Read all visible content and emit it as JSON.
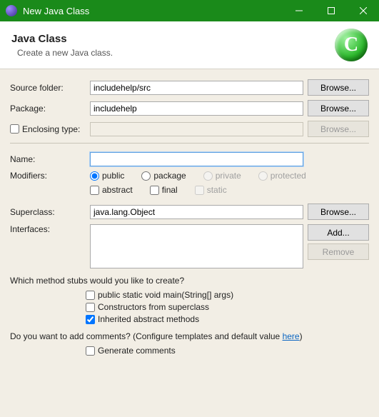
{
  "window": {
    "title": "New Java Class"
  },
  "header": {
    "heading": "Java Class",
    "description": "Create a new Java class.",
    "icon_letter": "C"
  },
  "labels": {
    "source_folder": "Source folder:",
    "package": "Package:",
    "enclosing_type": "Enclosing type:",
    "name": "Name:",
    "modifiers": "Modifiers:",
    "superclass": "Superclass:",
    "interfaces": "Interfaces:"
  },
  "fields": {
    "source_folder": "includehelp/src",
    "package": "includehelp",
    "enclosing_type": "",
    "name": "",
    "superclass": "java.lang.Object"
  },
  "buttons": {
    "browse": "Browse...",
    "add": "Add...",
    "remove": "Remove"
  },
  "modifiers": {
    "public": "public",
    "package": "package",
    "private": "private",
    "protected": "protected",
    "abstract": "abstract",
    "final": "final",
    "static": "static"
  },
  "stubs": {
    "question": "Which method stubs would you like to create?",
    "main": "public static void main(String[] args)",
    "constructors": "Constructors from superclass",
    "inherited": "Inherited abstract methods"
  },
  "comments": {
    "question_prefix": "Do you want to add comments? (Configure templates and default value ",
    "link": "here",
    "question_suffix": ")",
    "generate": "Generate comments"
  }
}
